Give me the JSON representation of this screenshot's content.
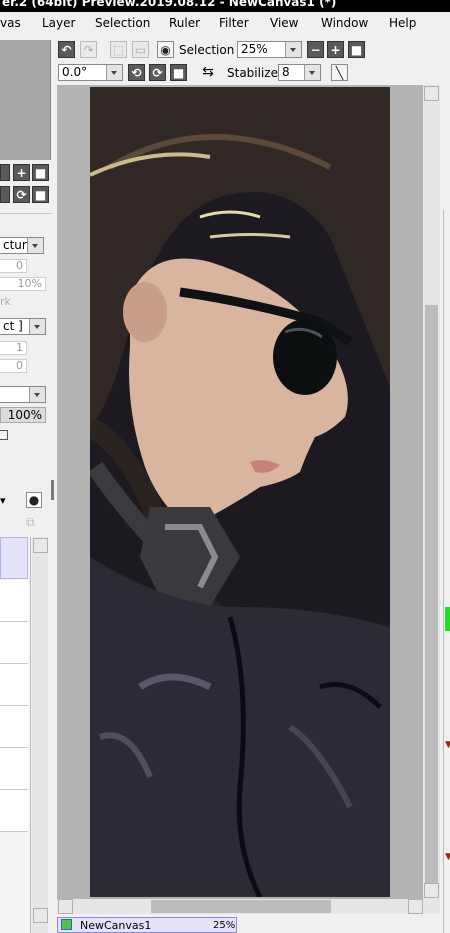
{
  "window": {
    "title": "er.2 (64bit) Preview.2019.08.12 - NewCanvas1 (*)"
  },
  "menu": [
    "vas",
    "Layer",
    "Selection",
    "Ruler",
    "Filter",
    "View",
    "Window",
    "Help"
  ],
  "toolbar1": {
    "selection_label": "Selection",
    "zoom_value": "25%"
  },
  "toolbar2": {
    "rotation_value": "0.0°",
    "stabilizer_label": "Stabilizer",
    "stabilizer_value": "8"
  },
  "left_panel": {
    "blend_mode": "cture ]",
    "value_0a": "0",
    "value_10": "10%",
    "label_rk": "rk",
    "effect_mode": "ct ]",
    "value_1": "1",
    "value_0b": "0",
    "opacity": "100%"
  },
  "status": {
    "canvas_name": "NewCanvas1",
    "canvas_zoom": "25%"
  },
  "colors": {
    "canvas_bg": "#b3b3b3",
    "titlebar": "#000000",
    "selected_row": "#e5e3fa",
    "color_swatch": "#22dd22"
  }
}
